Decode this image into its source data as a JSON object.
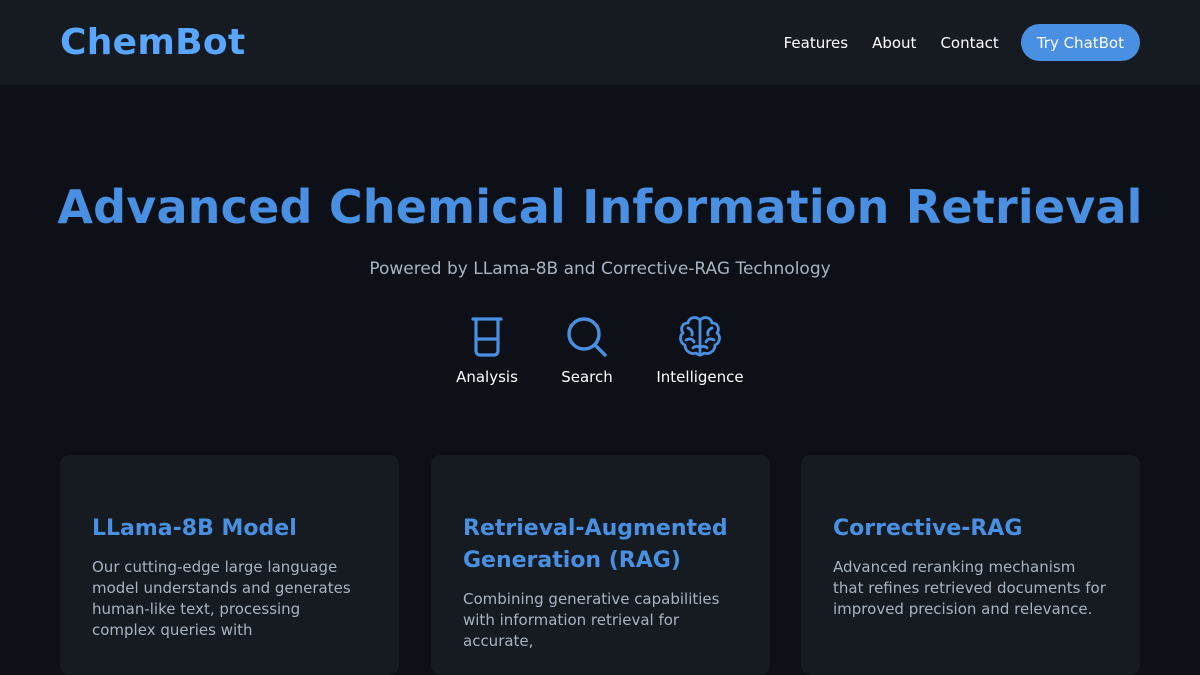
{
  "nav": {
    "logo": "ChemBot",
    "links": [
      "Features",
      "About",
      "Contact"
    ],
    "cta": "Try ChatBot"
  },
  "hero": {
    "title": "Advanced Chemical Information Retrieval",
    "subtitle": "Powered by LLama-8B and Corrective-RAG Technology",
    "icons": [
      {
        "icon": "beaker-icon",
        "label": "Analysis"
      },
      {
        "icon": "search-icon",
        "label": "Search"
      },
      {
        "icon": "brain-icon",
        "label": "Intelligence"
      }
    ]
  },
  "features": [
    {
      "title": "LLama-8B Model",
      "text": "Our cutting-edge large language model understands and generates human-like text, processing complex queries with"
    },
    {
      "title": "Retrieval-Augmented Generation (RAG)",
      "text": "Combining generative capabilities with information retrieval for accurate,"
    },
    {
      "title": "Corrective-RAG",
      "text": "Advanced reranking mechanism that refines retrieved documents for improved precision and relevance."
    }
  ],
  "colors": {
    "accent": "#4a90e2",
    "background": "#0d1117",
    "surface": "#161b22",
    "muted_text": "#a8b3c2"
  }
}
